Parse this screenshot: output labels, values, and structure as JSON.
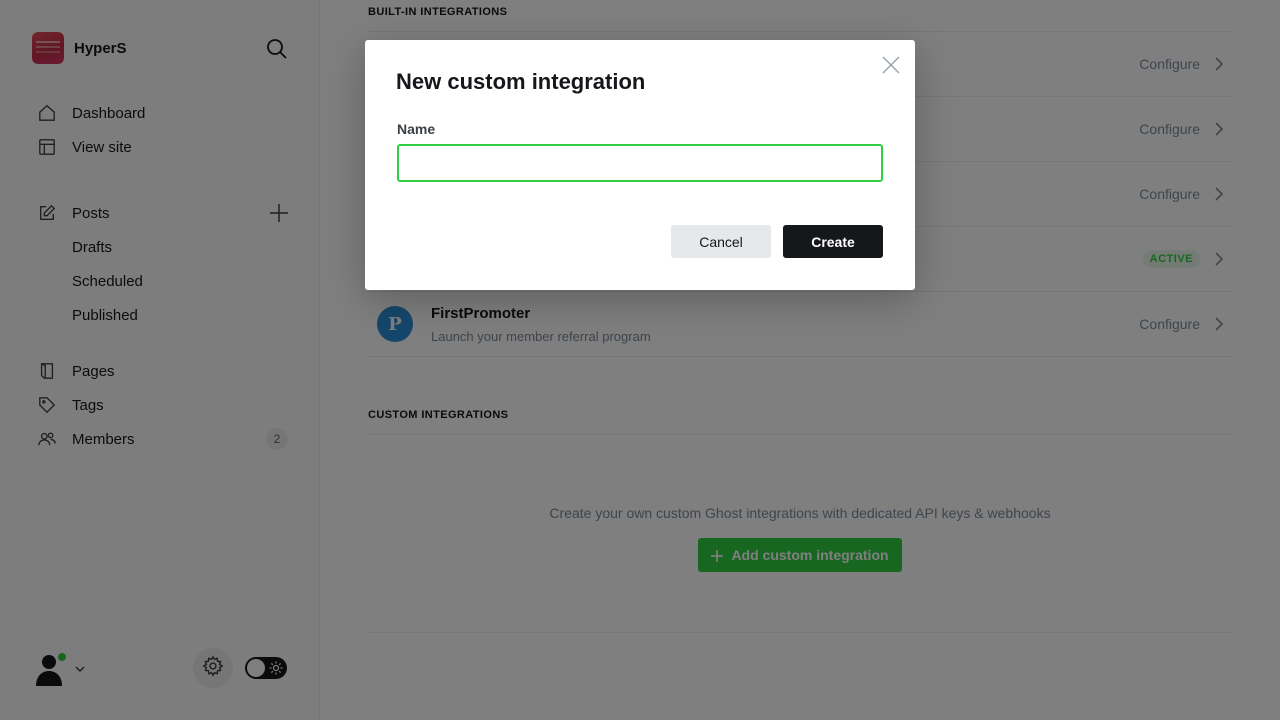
{
  "brand": {
    "name": "HyperS",
    "icon": "site-logo"
  },
  "sidebar": {
    "nav": [
      {
        "label": "Dashboard",
        "icon": "home-icon"
      },
      {
        "label": "View site",
        "icon": "layout-icon"
      }
    ],
    "posts": {
      "label": "Posts",
      "icon": "edit-icon",
      "sub": [
        "Drafts",
        "Scheduled",
        "Published"
      ]
    },
    "more": [
      {
        "label": "Pages",
        "icon": "page-icon"
      },
      {
        "label": "Tags",
        "icon": "tag-icon"
      },
      {
        "label": "Members",
        "icon": "members-icon",
        "count": "2"
      }
    ]
  },
  "main": {
    "builtin_title": "BUILT-IN INTEGRATIONS",
    "rows": [
      {
        "action": "Configure"
      },
      {
        "action": "Configure"
      },
      {
        "action": "Configure"
      },
      {
        "status": "ACTIVE"
      },
      {
        "title": "FirstPromoter",
        "description": "Launch your member referral program",
        "action": "Configure"
      }
    ],
    "custom_title": "CUSTOM INTEGRATIONS",
    "custom_description": "Create your own custom Ghost integrations with dedicated API keys & webhooks",
    "add_button": "Add custom integration"
  },
  "modal": {
    "title": "New custom integration",
    "name_label": "Name",
    "name_value": "",
    "cancel": "Cancel",
    "create": "Create"
  },
  "colors": {
    "accent": "#30cf43",
    "dark": "#15171a",
    "muted": "#7c8b9a"
  }
}
